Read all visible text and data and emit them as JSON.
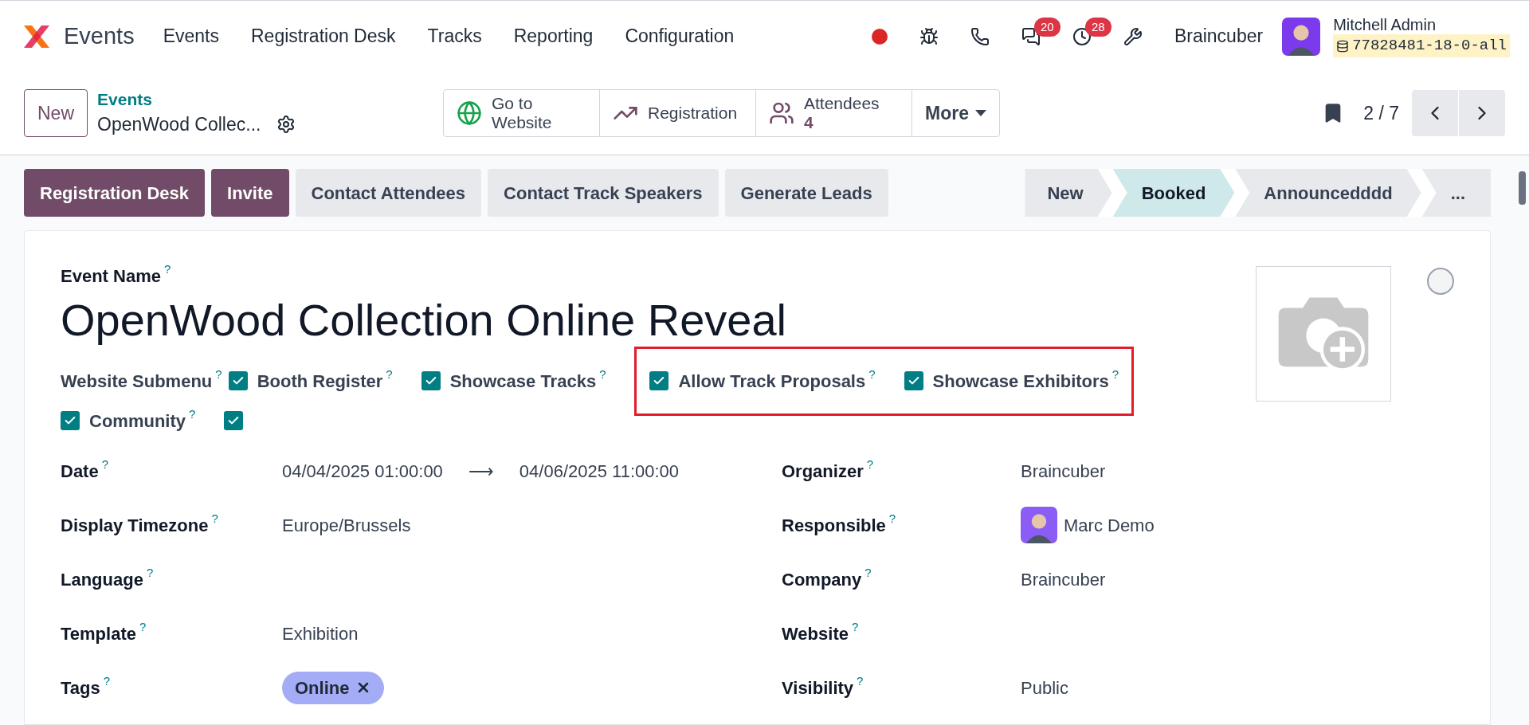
{
  "navbar": {
    "app_name": "Events",
    "menu": [
      {
        "label": "Events"
      },
      {
        "label": "Registration Desk"
      },
      {
        "label": "Tracks"
      },
      {
        "label": "Reporting"
      },
      {
        "label": "Configuration"
      }
    ],
    "systray": [
      {
        "kind": "record",
        "color": "#dc2626"
      },
      {
        "kind": "bug"
      },
      {
        "kind": "phone"
      },
      {
        "kind": "chat",
        "badge": "20"
      },
      {
        "kind": "activity",
        "badge": "28"
      },
      {
        "kind": "tools"
      }
    ],
    "company": "Braincuber",
    "user": {
      "name": "Mitchell Admin",
      "database": "77828481-18-0-all"
    }
  },
  "control_panel": {
    "new_button": "New",
    "breadcrumb": {
      "parent": "Events",
      "current": "OpenWood Collec..."
    },
    "smart_buttons": [
      {
        "kind": "website",
        "label": "Go to Website"
      },
      {
        "kind": "chart",
        "label": "Registration"
      },
      {
        "kind": "people",
        "label": "Attendees",
        "value": "4"
      },
      {
        "kind": "more",
        "label": "More"
      }
    ],
    "pager": "2 / 7"
  },
  "actions": [
    {
      "label": "Registration Desk",
      "primary": true
    },
    {
      "label": "Invite",
      "primary": true
    },
    {
      "label": "Contact Attendees",
      "primary": false
    },
    {
      "label": "Contact Track Speakers",
      "primary": false
    },
    {
      "label": "Generate Leads",
      "primary": false
    }
  ],
  "stages": [
    {
      "label": "New",
      "selected": false
    },
    {
      "label": "Booked",
      "selected": true
    },
    {
      "label": "Announcedddd",
      "selected": false
    },
    {
      "label": "...",
      "selected": false
    }
  ],
  "form": {
    "name_label": "Event Name",
    "name_help": "?",
    "name": "OpenWood Collection Online Reveal",
    "submenu": {
      "label": "Website Submenu",
      "help": "?",
      "lines": [
        [
          {
            "highlighted": false,
            "items": [
              {
                "label": "Booth Register",
                "help": "?",
                "checked": true
              },
              {
                "label": "Showcase Tracks",
                "help": "?",
                "checked": true
              }
            ]
          },
          {
            "highlighted": true,
            "items": [
              {
                "label": "Allow Track Proposals",
                "help": "?",
                "checked": true
              },
              {
                "label": "Showcase Exhibitors",
                "help": "?",
                "checked": true
              }
            ]
          }
        ],
        [
          {
            "highlighted": false,
            "items": [
              {
                "label": "Community",
                "help": "?",
                "checked": true
              },
              {
                "checked": true
              }
            ]
          }
        ]
      ]
    },
    "left_fields": [
      {
        "label": "Date",
        "help": "?",
        "kind": "range",
        "start": "04/04/2025 01:00:00",
        "arrow": "⟶",
        "end": "04/06/2025 11:00:00"
      },
      {
        "label": "Display Timezone",
        "help": "?",
        "kind": "text",
        "value": "Europe/Brussels"
      },
      {
        "label": "Language",
        "help": "?",
        "kind": "text"
      },
      {
        "label": "Template",
        "help": "?",
        "kind": "text",
        "value": "Exhibition"
      },
      {
        "label": "Tags",
        "help": "?",
        "kind": "tags",
        "tags": [
          {
            "label": "Online",
            "color": "#a3acf5"
          }
        ]
      }
    ],
    "right_fields": [
      {
        "label": "Organizer",
        "help": "?",
        "kind": "text",
        "value": "Braincuber"
      },
      {
        "label": "Responsible",
        "help": "?",
        "kind": "user",
        "value": "Marc Demo"
      },
      {
        "label": "Company",
        "help": "?",
        "kind": "text",
        "value": "Braincuber"
      },
      {
        "label": "Website",
        "help": "?",
        "kind": "text"
      },
      {
        "label": "Visibility",
        "help": "?",
        "kind": "text",
        "value": "Public"
      }
    ]
  }
}
